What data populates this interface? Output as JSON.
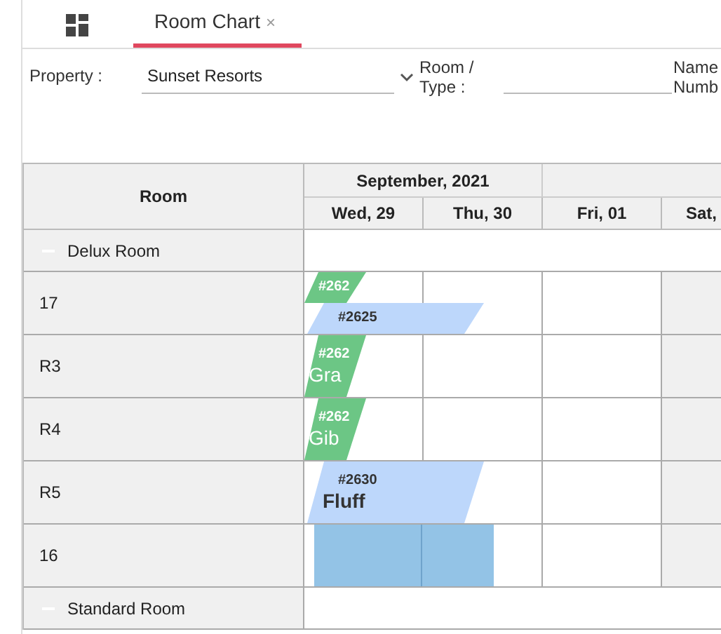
{
  "tabs": [
    {
      "label": "Room Chart",
      "close": "×",
      "selected": true
    }
  ],
  "filters": [
    {
      "kind": "select",
      "label": "Property :",
      "value": "Sunset Resorts"
    },
    {
      "kind": "input",
      "label": "Room /\nType :"
    },
    {
      "kind": "label",
      "label": "Name\nNumb"
    }
  ],
  "chart": {
    "room_header": "Room",
    "month": "September, 2021",
    "days": [
      "Wed, 29",
      "Thu, 30",
      "Fri, 01",
      "Sat,"
    ],
    "rows": [
      {
        "kind": "group",
        "label": "Delux Room"
      },
      {
        "kind": "room",
        "label": "17",
        "selected": false,
        "bookings": [
          {
            "kind": "checked_in",
            "number": "#262"
          },
          {
            "kind": "reserved",
            "number": "#2625"
          }
        ]
      },
      {
        "kind": "room",
        "label": "R3",
        "selected": false,
        "bookings": [
          {
            "kind": "checked_in",
            "number": "#262",
            "guest": "Gra"
          }
        ]
      },
      {
        "kind": "room",
        "label": "R4",
        "selected": false,
        "bookings": [
          {
            "kind": "checked_in",
            "number": "#262",
            "guest": "Gib"
          }
        ]
      },
      {
        "kind": "room",
        "label": "R5",
        "selected": false,
        "bookings": [
          {
            "kind": "reserved",
            "number": "#2630",
            "guest": "Fluff"
          }
        ]
      },
      {
        "kind": "room",
        "label": "16",
        "selected": true,
        "bookings": []
      },
      {
        "kind": "group",
        "label": "Standard Room"
      }
    ]
  }
}
